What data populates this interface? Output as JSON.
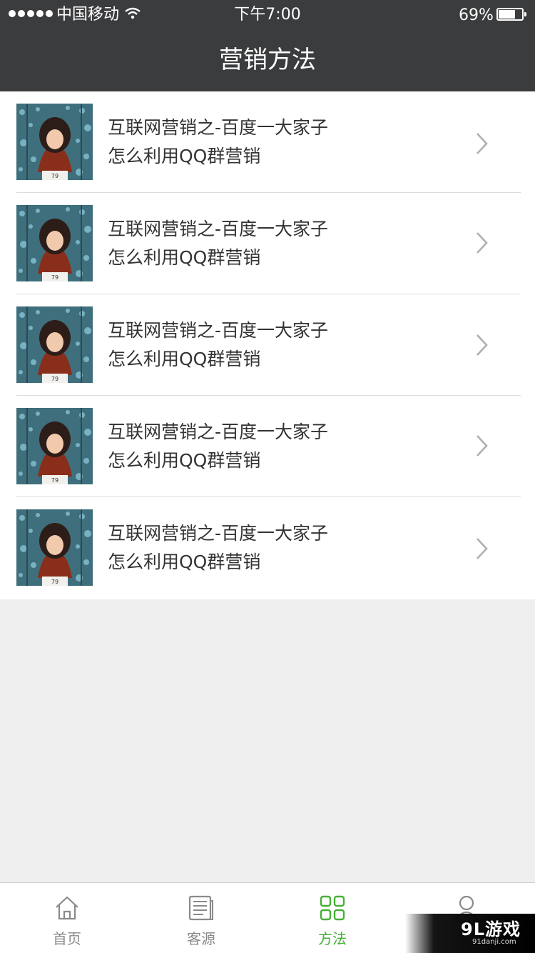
{
  "status_bar": {
    "carrier": "中国移动",
    "time": "下午7:00",
    "battery_percent": "69%",
    "battery_level": 0.69,
    "signal_dots": 5
  },
  "nav": {
    "title": "营销方法"
  },
  "articles": [
    {
      "title": "互联网营销之-百度一大家子",
      "subtitle": "怎么利用QQ群营销",
      "thumbnail_icon": "girl-photo"
    },
    {
      "title": "互联网营销之-百度一大家子",
      "subtitle": "怎么利用QQ群营销",
      "thumbnail_icon": "girl-photo"
    },
    {
      "title": "互联网营销之-百度一大家子",
      "subtitle": "怎么利用QQ群营销",
      "thumbnail_icon": "girl-photo"
    },
    {
      "title": "互联网营销之-百度一大家子",
      "subtitle": "怎么利用QQ群营销",
      "thumbnail_icon": "girl-photo"
    },
    {
      "title": "互联网营销之-百度一大家子",
      "subtitle": "怎么利用QQ群营销",
      "thumbnail_icon": "girl-photo"
    }
  ],
  "tabbar": {
    "tabs": [
      {
        "label": "首页",
        "icon": "home-icon",
        "active": false
      },
      {
        "label": "客源",
        "icon": "document-icon",
        "active": false
      },
      {
        "label": "方法",
        "icon": "grid-icon",
        "active": true
      },
      {
        "label": "",
        "icon": "user-icon",
        "active": false
      }
    ]
  },
  "watermark": {
    "logo": "9L游戏",
    "site": "91danji.com"
  },
  "colors": {
    "header_bg": "#3b3c3e",
    "accent_green": "#44b036",
    "inactive_gray": "#8a8a8a",
    "page_bg": "#efefef"
  }
}
